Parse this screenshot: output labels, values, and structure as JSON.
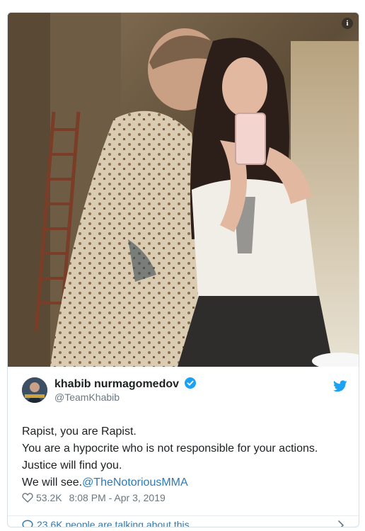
{
  "tweet": {
    "display_name": "khabib nurmagomedov",
    "handle": "@TeamKhabib",
    "text_lines": [
      "Rapist, you are Rapist.",
      "You are a hypocrite who is not responsible for your actions.",
      "Justice will find you.",
      "We will see."
    ],
    "mention": "@TheNotoriousMMA",
    "likes": "53.2K",
    "timestamp": "8:08 PM - Apr 3, 2019",
    "talking": "23.6K people are talking about this"
  },
  "icons": {
    "info": "info-icon",
    "verified": "verified-badge-icon",
    "bird": "twitter-bird-icon",
    "heart": "heart-icon",
    "bubble": "speech-bubble-icon",
    "chevron": "chevron-right-icon"
  },
  "colors": {
    "link": "#2b7bb9",
    "twitter_blue": "#1da1f2",
    "text": "#1c2022",
    "muted": "#697882",
    "border": "#d6dfe6"
  }
}
